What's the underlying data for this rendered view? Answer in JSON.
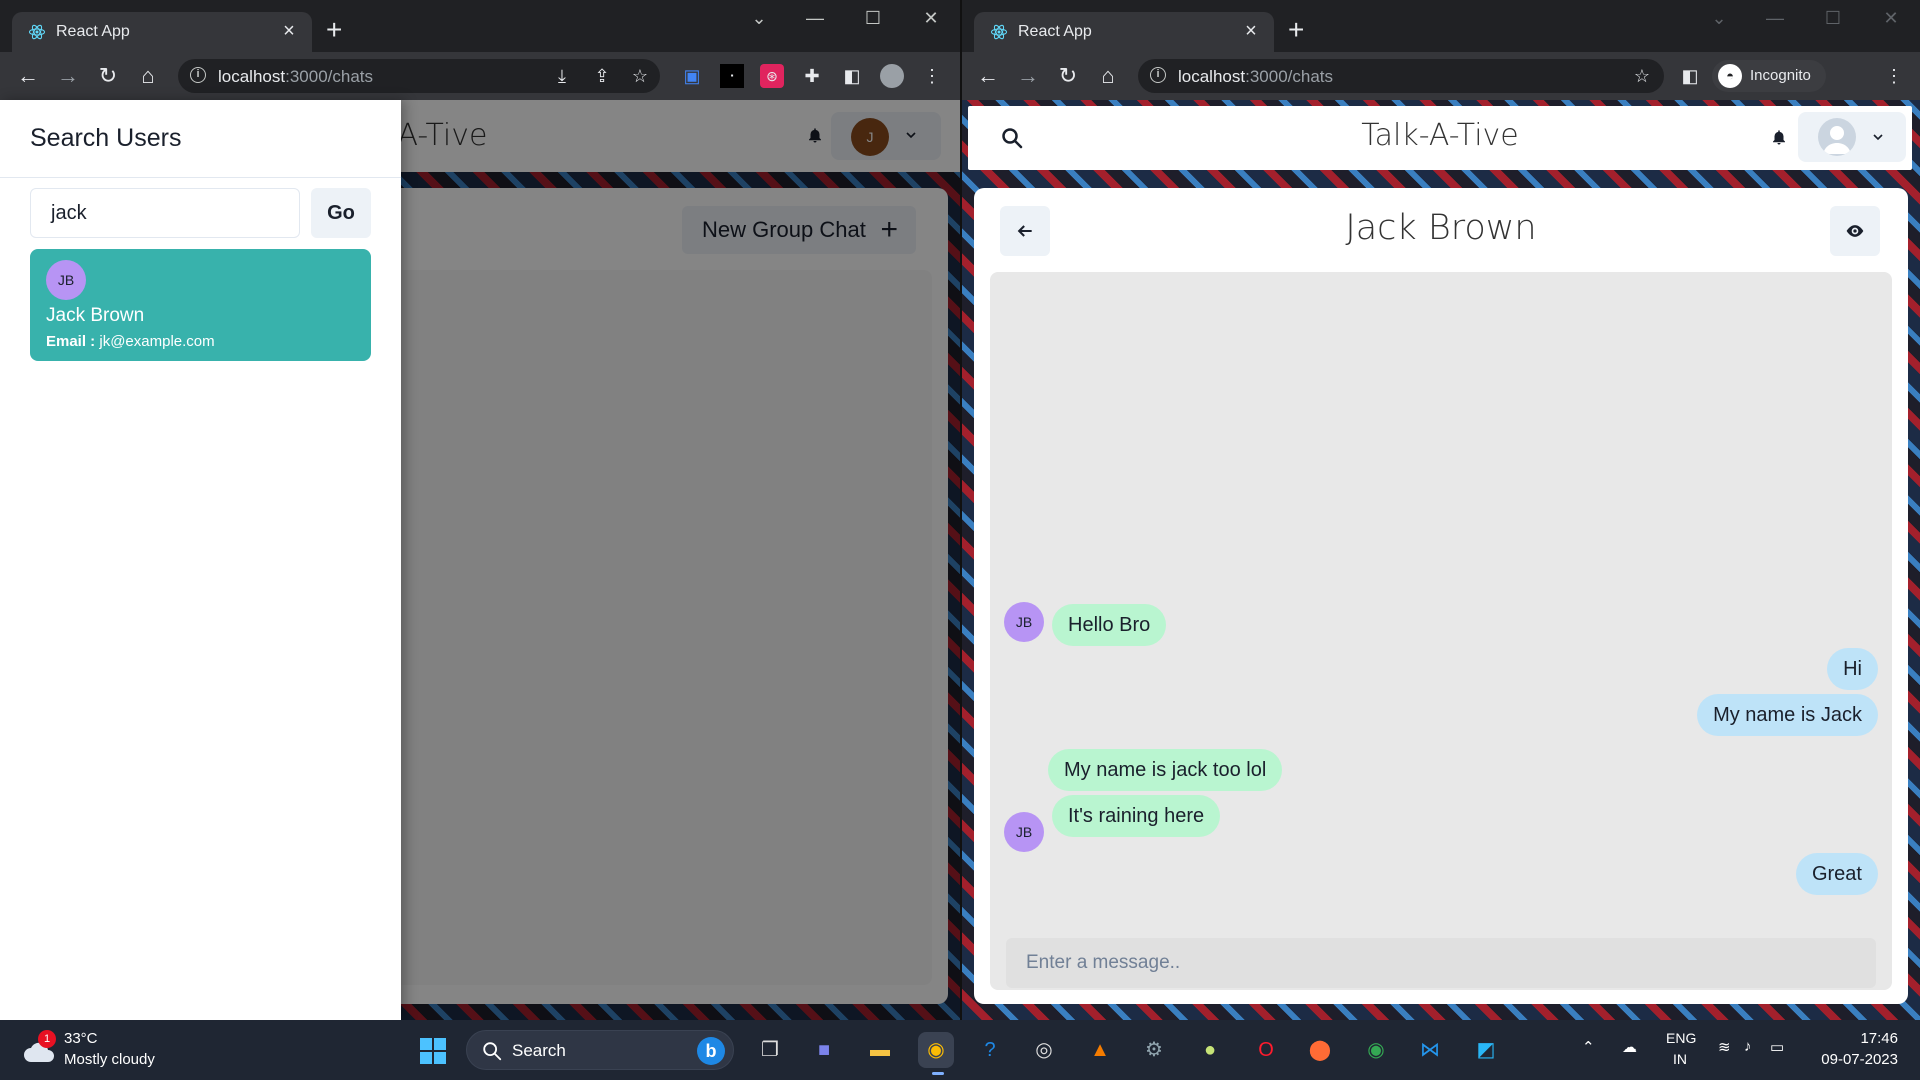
{
  "left_browser": {
    "tab_title": "React App",
    "url_host": "localhost",
    "url_rest": ":3000/chats"
  },
  "right_browser": {
    "tab_title": "React App",
    "url_host": "localhost",
    "url_rest": ":3000/chats",
    "incognito_label": "Incognito"
  },
  "left_app": {
    "title_partial": "k-A-Tive",
    "avatar_initial": "J",
    "new_group_label": "New Group Chat"
  },
  "drawer": {
    "title": "Search Users",
    "search_value": "jack",
    "go_label": "Go",
    "results": [
      {
        "initials": "JB",
        "name": "Jack Brown",
        "email_label": "Email :",
        "email": "jk@example.com"
      }
    ]
  },
  "right_app": {
    "title": "Talk-A-Tive",
    "chat_name": "Jack Brown",
    "input_placeholder": "Enter a message..",
    "messages": [
      {
        "text": "Hello Bro",
        "sender": "JB",
        "direction": "in",
        "show_avatar": true
      },
      {
        "text": "Hi",
        "direction": "out"
      },
      {
        "text": "My name is Jack",
        "direction": "out"
      },
      {
        "text": "My name is jack too lol",
        "sender": "JB",
        "direction": "in",
        "show_avatar": false
      },
      {
        "text": "It's raining here",
        "sender": "JB",
        "direction": "in",
        "show_avatar": true
      },
      {
        "text": "Great",
        "direction": "out"
      }
    ]
  },
  "taskbar": {
    "weather_badge": "1",
    "temperature": "33°C",
    "weather": "Mostly cloudy",
    "search_label": "Search",
    "lang_top": "ENG",
    "lang_bottom": "IN",
    "time": "17:46",
    "date": "09-07-2023"
  },
  "colors": {
    "teal": "#38b2ac",
    "incoming_bubble": "#b9f5d0",
    "outgoing_bubble": "#bee3f8",
    "avatar_purple": "#b794f4"
  }
}
